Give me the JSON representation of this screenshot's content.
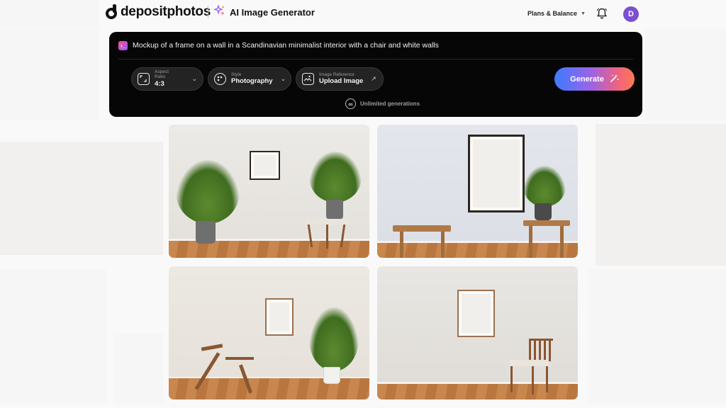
{
  "brand": {
    "name": "depositphotos"
  },
  "header": {
    "tool_title": "AI Image Generator",
    "plans_label": "Plans & Balance",
    "avatar_initial": "D"
  },
  "prompt": {
    "text": "Mockup of a frame on a wall in a Scandinavian minimalist interior with a chair and white walls"
  },
  "options": {
    "aspect_ratio": {
      "label": "Aspect Ratio",
      "value": "4:3"
    },
    "style": {
      "label": "Style",
      "value": "Photography"
    },
    "image_reference": {
      "label": "Image Reference",
      "value": "Upload Image"
    }
  },
  "generate_label": "Generate",
  "unlimited_label": "Unlimited generations",
  "colors": {
    "panel_bg": "#060606",
    "avatar": "#7b4fd1",
    "generate_gradient": [
      "#3d7bff",
      "#9b63e8",
      "#f0637e",
      "#ff7a52"
    ]
  },
  "icons": {
    "bell": "bell-icon",
    "aspect": "aspect-ratio-icon",
    "style": "palette-icon",
    "reference": "image-upload-icon",
    "generate": "magic-wand-icon",
    "unlimited": "infinity-icon",
    "prompt": "terminal-prompt-icon"
  }
}
